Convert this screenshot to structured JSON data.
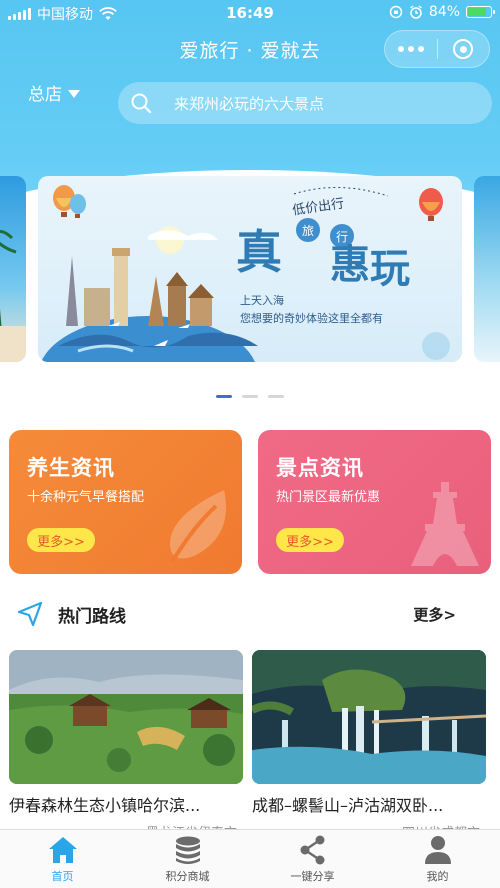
{
  "status_bar": {
    "carrier": "中国移动",
    "time": "16:49",
    "battery": "84%",
    "battery_level": 0.84
  },
  "nav": {
    "title": "爱旅行 · 爱就去"
  },
  "store": {
    "label": "总店"
  },
  "search": {
    "placeholder": "来郑州必玩的六大景点"
  },
  "banner": {
    "tag": "低价出行",
    "big_1": "真",
    "small_1": "旅",
    "small_2": "行",
    "big_2": "惠",
    "big_3": "玩",
    "sub_1": "上天入海",
    "sub_2": "您想要的奇妙体验这里全都有",
    "active_index": 0,
    "page_count": 3
  },
  "cards": [
    {
      "title": "养生资讯",
      "desc": "十余种元气早餐搭配",
      "more": "更多>>",
      "color": "#f07a30"
    },
    {
      "title": "景点资讯",
      "desc": "热门景区最新优惠",
      "more": "更多>>",
      "color": "#e9607c"
    }
  ],
  "section": {
    "title": "热门路线",
    "more": "更多>"
  },
  "routes": [
    {
      "name": "伊春森林生态小镇哈尔滨...",
      "place": "黑龙江省伊春市"
    },
    {
      "name": "成都–螺髻山–泸沽湖双卧...",
      "place": "四川省成都市"
    }
  ],
  "tabs": [
    {
      "label": "首页",
      "icon": "home-icon",
      "active": true
    },
    {
      "label": "积分商城",
      "icon": "coins-icon",
      "active": false
    },
    {
      "label": "一键分享",
      "icon": "share-icon",
      "active": false
    },
    {
      "label": "我的",
      "icon": "user-icon",
      "active": false
    }
  ],
  "colors": {
    "header": "#57c6f2",
    "accent": "#2aa6e8",
    "indicator": "#3d6fd9",
    "more_button": "#ffe74a"
  }
}
